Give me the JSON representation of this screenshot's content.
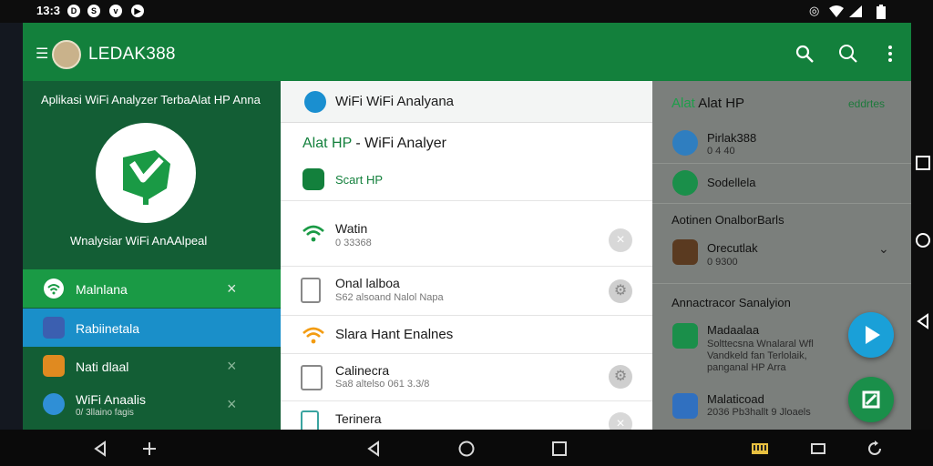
{
  "status_bar": {
    "time": "13:3",
    "left_icons": [
      "d-icon",
      "s-icon",
      "play-icon"
    ],
    "right_icons": [
      "gps-icon",
      "wifi-icon",
      "signal-icon",
      "battery-icon"
    ]
  },
  "app_bar": {
    "title": "LEDAK388",
    "menu_icon": "menu-icon",
    "actions": [
      "search-icon",
      "search-icon",
      "more-vert-icon"
    ]
  },
  "left_panel": {
    "heading": "Aplikasi WiFi Analyzer TerbaAlat HP Anna",
    "caption": "Wnalysiar WiFi AnAAlpeal",
    "items": [
      {
        "label": "Malnlana",
        "sub": "",
        "icon": "wifi-icon",
        "active": "green",
        "close": "×"
      },
      {
        "label": "Rabiinetala",
        "sub": "",
        "icon": "device-icon",
        "active": "blue",
        "close": ""
      },
      {
        "label": "Nati dlaal",
        "sub": "",
        "icon": "folder-icon",
        "active": "",
        "close": "×"
      },
      {
        "label": "WiFi Anaalis",
        "sub": "0/ 3llaino fagis",
        "icon": "globe-icon",
        "active": "",
        "close": "×"
      }
    ]
  },
  "middle_panel": {
    "tab_title": "WiFi WiFi Analyana",
    "subtitle_green": "Alat HP",
    "subtitle_rest": " - WiFi Analyer",
    "start_label": "Scart HP",
    "rows": [
      {
        "label": "Watin",
        "sub": "0 33368",
        "icon": "wifi-icon",
        "action": "×"
      },
      {
        "label": "Onal lalboa",
        "sub": "S62 alsoand Nalol Napa",
        "icon": "tablet-icon",
        "action": "⚙"
      },
      {
        "label": "Slara Hant Enalnes",
        "sub": "",
        "icon": "wifi-orange-icon",
        "action": ""
      },
      {
        "label": "Calinecra",
        "sub": "Sa8 altelso 061 3.3/8",
        "icon": "device-icon",
        "action": "⚙"
      },
      {
        "label": "Terinera",
        "sub": "",
        "icon": "phone-icon",
        "action": "×"
      }
    ]
  },
  "right_panel": {
    "heading_green": "Alat",
    "heading_rest": " Alat HP",
    "heading_right": "eddrtes",
    "items_top": [
      {
        "label": "Pirlak388",
        "sub": "0 4 40",
        "icon": "user-icon"
      },
      {
        "label": "Sodellela",
        "sub": "",
        "icon": "eye-icon"
      }
    ],
    "section1": "Aotinen OnalborBarls",
    "section1_items": [
      {
        "label": "Orecutlak",
        "sub": "0 9300",
        "icon": "game-icon"
      }
    ],
    "section2": "Annactracor Sanalyion",
    "section2_items": [
      {
        "label": "Madaalaa",
        "sub": "Solttecsna Wnalaral Wfl Vandkeld fan Terlolaik, panganal HP Arra",
        "icon": "leaf-icon"
      },
      {
        "label": "Malaticoad",
        "sub": "2036 Pb3hallt 9 Jloaels",
        "icon": "chart-icon"
      }
    ],
    "fab_colors": {
      "blue": "#1aa0d8",
      "green": "#1a8f4a"
    }
  },
  "colors": {
    "app_bar": "#13803c",
    "left_panel": "#135e35",
    "accent_green": "#13803c",
    "active_blue": "#1a8fc9"
  },
  "nav": {
    "left": [
      "back-icon",
      "split-icon"
    ],
    "center": [
      "back-icon",
      "home-icon",
      "recents-icon"
    ],
    "right": [
      "keyboard-icon",
      "rotate-icon",
      "refresh-icon"
    ]
  }
}
